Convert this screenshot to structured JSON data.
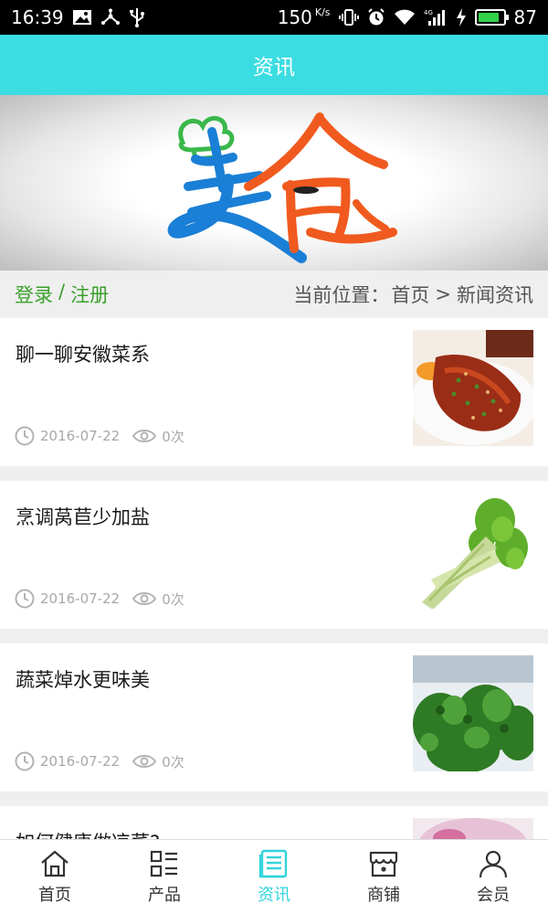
{
  "status_bar": {
    "time": "16:39",
    "speed": "150",
    "speed_unit": "K/s",
    "battery": "87",
    "battery_level": 0.87,
    "icons_left": [
      "image-icon",
      "share-icon",
      "usb-icon"
    ],
    "icons_right": [
      "vibrate-icon",
      "alarm-icon",
      "wifi-icon",
      "signal-4g-icon",
      "charging-icon",
      "battery-icon"
    ]
  },
  "header": {
    "title": "资讯"
  },
  "banner": {
    "logo_text": "美食"
  },
  "crumb": {
    "login": "登录",
    "separator": "/",
    "register": "注册",
    "location_label": "当前位置：",
    "home": "首页",
    "arrow": ">",
    "current": "新闻资讯"
  },
  "news": [
    {
      "title": "聊一聊安徽菜系",
      "date": "2016-07-22",
      "views": "0次",
      "image": "braised-dish-photo"
    },
    {
      "title": "烹调莴苣少加盐",
      "date": "2016-07-22",
      "views": "0次",
      "image": "lettuce-stem-photo"
    },
    {
      "title": "蔬菜焯水更味美",
      "date": "2016-07-22",
      "views": "0次",
      "image": "green-vegetables-photo"
    },
    {
      "title": "如何健康做凉菜?",
      "date": "",
      "views": "",
      "image": "dish-photo"
    }
  ],
  "tabs": [
    {
      "label": "首页",
      "icon": "home-icon",
      "active": false
    },
    {
      "label": "产品",
      "icon": "product-list-icon",
      "active": false
    },
    {
      "label": "资讯",
      "icon": "news-icon",
      "active": true
    },
    {
      "label": "商铺",
      "icon": "shop-icon",
      "active": false
    },
    {
      "label": "会员",
      "icon": "member-icon",
      "active": false
    }
  ],
  "colors": {
    "accent": "#3cdde2",
    "tab_active": "#33d4db",
    "login_green": "#3aa02b",
    "meta_gray": "#a8a8a8"
  }
}
